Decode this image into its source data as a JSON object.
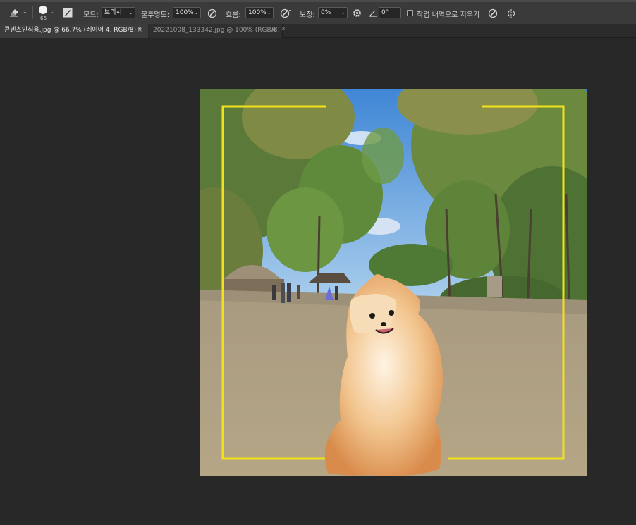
{
  "options_bar": {
    "brush_size": "66",
    "mode_label": "모드:",
    "mode_value": "브러시",
    "opacity_label": "불투명도:",
    "opacity_value": "100%",
    "flow_label": "흐름:",
    "flow_value": "100%",
    "smoothing_label": "보정:",
    "smoothing_value": "0%",
    "angle_value": "0°",
    "erase_history_label": "작업 내역으로 지우기"
  },
  "tabs": [
    {
      "label": "콘텐츠인식용.jpg @ 66.7% (레이어 4, RGB/8) *",
      "close": "×",
      "active": true
    },
    {
      "label": "20221008_133342.jpg @ 100% (RGB/8) *",
      "close": "×",
      "active": false
    }
  ],
  "colors": {
    "app_bg": "#282828",
    "frame_line": "#f2e21a"
  },
  "icons": [
    "eraser-icon",
    "brush-tip-icon",
    "brush-settings-icon",
    "airbrush-icon",
    "gear-icon",
    "angle-icon",
    "pressure-icon",
    "symmetry-icon"
  ]
}
